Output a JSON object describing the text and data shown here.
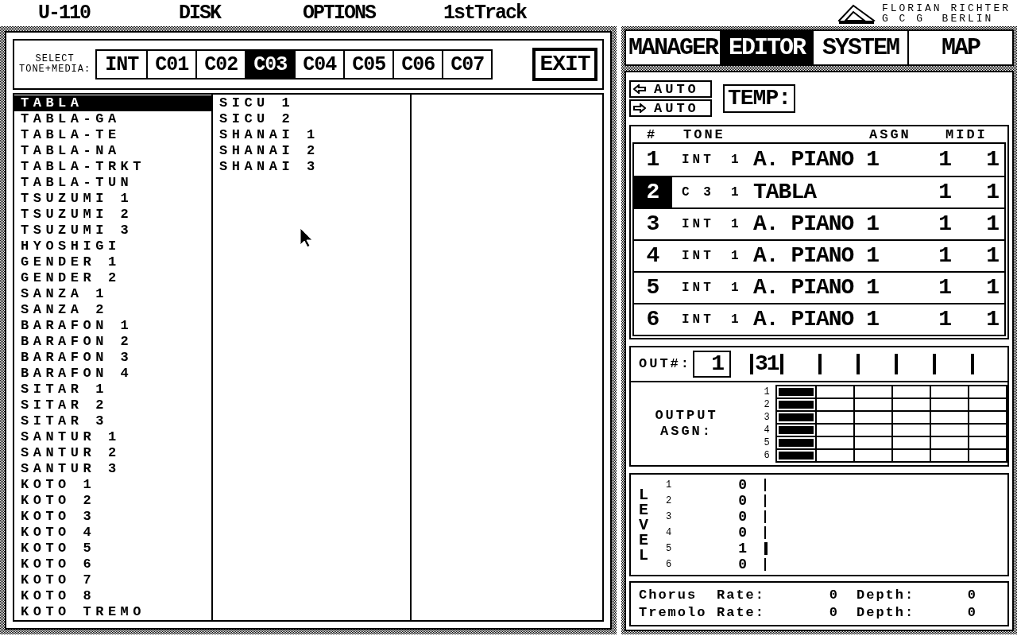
{
  "menu_bar": [
    "U-110",
    "DISK",
    "OPTIONS",
    "1stTrack"
  ],
  "logo": {
    "line_1": "FLORIAN RICHTER",
    "line_2": "G C G  BERLIN"
  },
  "select_label": "SELECT\nTONE+MEDIA:",
  "media_tabs": [
    {
      "label": "INT",
      "selected": false
    },
    {
      "label": "C01",
      "selected": false
    },
    {
      "label": "C02",
      "selected": false
    },
    {
      "label": "C03",
      "selected": true
    },
    {
      "label": "C04",
      "selected": false
    },
    {
      "label": "C05",
      "selected": false
    },
    {
      "label": "C06",
      "selected": false
    },
    {
      "label": "C07",
      "selected": false
    }
  ],
  "exit_button": "EXIT",
  "tone_list": {
    "column_1": [
      {
        "label": "TABLA",
        "selected": true
      },
      {
        "label": "TABLA-GA",
        "selected": false
      },
      {
        "label": "TABLA-TE",
        "selected": false
      },
      {
        "label": "TABLA-NA",
        "selected": false
      },
      {
        "label": "TABLA-TRKT",
        "selected": false
      },
      {
        "label": "TABLA-TUN",
        "selected": false
      },
      {
        "label": "TSUZUMI 1",
        "selected": false
      },
      {
        "label": "TSUZUMI 2",
        "selected": false
      },
      {
        "label": "TSUZUMI 3",
        "selected": false
      },
      {
        "label": "HYOSHIGI",
        "selected": false
      },
      {
        "label": "GENDER 1",
        "selected": false
      },
      {
        "label": "GENDER 2",
        "selected": false
      },
      {
        "label": "SANZA 1",
        "selected": false
      },
      {
        "label": "SANZA 2",
        "selected": false
      },
      {
        "label": "BARAFON 1",
        "selected": false
      },
      {
        "label": "BARAFON 2",
        "selected": false
      },
      {
        "label": "BARAFON 3",
        "selected": false
      },
      {
        "label": "BARAFON 4",
        "selected": false
      },
      {
        "label": "SITAR 1",
        "selected": false
      },
      {
        "label": "SITAR 2",
        "selected": false
      },
      {
        "label": "SITAR 3",
        "selected": false
      },
      {
        "label": "SANTUR 1",
        "selected": false
      },
      {
        "label": "SANTUR 2",
        "selected": false
      },
      {
        "label": "SANTUR 3",
        "selected": false
      },
      {
        "label": "KOTO 1",
        "selected": false
      },
      {
        "label": "KOTO 2",
        "selected": false
      },
      {
        "label": "KOTO 3",
        "selected": false
      },
      {
        "label": "KOTO 4",
        "selected": false
      },
      {
        "label": "KOTO 5",
        "selected": false
      },
      {
        "label": "KOTO 6",
        "selected": false
      },
      {
        "label": "KOTO 7",
        "selected": false
      },
      {
        "label": "KOTO 8",
        "selected": false
      },
      {
        "label": "KOTO TREMO",
        "selected": false
      }
    ],
    "column_2": [
      {
        "label": "SICU 1",
        "selected": false
      },
      {
        "label": "SICU 2",
        "selected": false
      },
      {
        "label": "SHANAI 1",
        "selected": false
      },
      {
        "label": "SHANAI 2",
        "selected": false
      },
      {
        "label": "SHANAI 3",
        "selected": false
      }
    ]
  },
  "mode_tabs": [
    {
      "label": "MANAGER",
      "selected": false
    },
    {
      "label": "EDITOR",
      "selected": true
    },
    {
      "label": "SYSTEM",
      "selected": false
    },
    {
      "label": "MAP",
      "selected": false
    }
  ],
  "auto_buttons": [
    {
      "kind": "left",
      "label": "AUTO"
    },
    {
      "kind": "right",
      "label": "AUTO"
    }
  ],
  "temp_button": "TEMP:",
  "part_table": {
    "columns": [
      "#",
      "TONE",
      "ASGN",
      "MIDI"
    ],
    "rows": [
      {
        "number": "1",
        "source": "INT",
        "bank": "1",
        "tone": "A. PIANO 1",
        "asgn": "1",
        "midi": "1",
        "selected": false
      },
      {
        "number": "2",
        "source": "C 3",
        "bank": "1",
        "tone": "TABLA",
        "asgn": "1",
        "midi": "1",
        "selected": true
      },
      {
        "number": "3",
        "source": "INT",
        "bank": "1",
        "tone": "A. PIANO 1",
        "asgn": "1",
        "midi": "1",
        "selected": false
      },
      {
        "number": "4",
        "source": "INT",
        "bank": "1",
        "tone": "A. PIANO 1",
        "asgn": "1",
        "midi": "1",
        "selected": false
      },
      {
        "number": "5",
        "source": "INT",
        "bank": "1",
        "tone": "A. PIANO 1",
        "asgn": "1",
        "midi": "1",
        "selected": false
      },
      {
        "number": "6",
        "source": "INT",
        "bank": "1",
        "tone": "A. PIANO 1",
        "asgn": "1",
        "midi": "1",
        "selected": false
      }
    ]
  },
  "out": {
    "label": "OUT#:",
    "value": "1",
    "channels": [
      "31"
    ]
  },
  "output_assign": {
    "label": "OUTPUT\nASGN:",
    "rows": [
      {
        "label": "1",
        "cells": [
          {
            "on": true
          },
          {
            "on": false
          },
          {
            "on": false
          },
          {
            "on": false
          },
          {
            "on": false
          },
          {
            "on": false
          }
        ]
      },
      {
        "label": "2",
        "cells": [
          {
            "on": true
          },
          {
            "on": false
          },
          {
            "on": false
          },
          {
            "on": false
          },
          {
            "on": false
          },
          {
            "on": false
          }
        ]
      },
      {
        "label": "3",
        "cells": [
          {
            "on": true
          },
          {
            "on": false
          },
          {
            "on": false
          },
          {
            "on": false
          },
          {
            "on": false
          },
          {
            "on": false
          }
        ]
      },
      {
        "label": "4",
        "cells": [
          {
            "on": true
          },
          {
            "on": false
          },
          {
            "on": false
          },
          {
            "on": false
          },
          {
            "on": false
          },
          {
            "on": false
          }
        ]
      },
      {
        "label": "5",
        "cells": [
          {
            "on": true
          },
          {
            "on": false
          },
          {
            "on": false
          },
          {
            "on": false
          },
          {
            "on": false
          },
          {
            "on": false
          }
        ]
      },
      {
        "label": "6",
        "cells": [
          {
            "on": true
          },
          {
            "on": false
          },
          {
            "on": false
          },
          {
            "on": false
          },
          {
            "on": false
          },
          {
            "on": false
          }
        ]
      }
    ]
  },
  "levels": {
    "label": "LEVEL",
    "rows": [
      {
        "label": "1",
        "value": "0",
        "level": 0
      },
      {
        "label": "2",
        "value": "0",
        "level": 0
      },
      {
        "label": "3",
        "value": "0",
        "level": 0
      },
      {
        "label": "4",
        "value": "0",
        "level": 0
      },
      {
        "label": "5",
        "value": "1",
        "level": 0.008
      },
      {
        "label": "6",
        "value": "0",
        "level": 0
      }
    ]
  },
  "effects": [
    {
      "name": "Chorus",
      "rate_label": "Rate:",
      "rate": "0",
      "depth_label": "Depth:",
      "depth": "0"
    },
    {
      "name": "Tremolo",
      "rate_label": "Rate:",
      "rate": "0",
      "depth_label": "Depth:",
      "depth": "0"
    }
  ]
}
